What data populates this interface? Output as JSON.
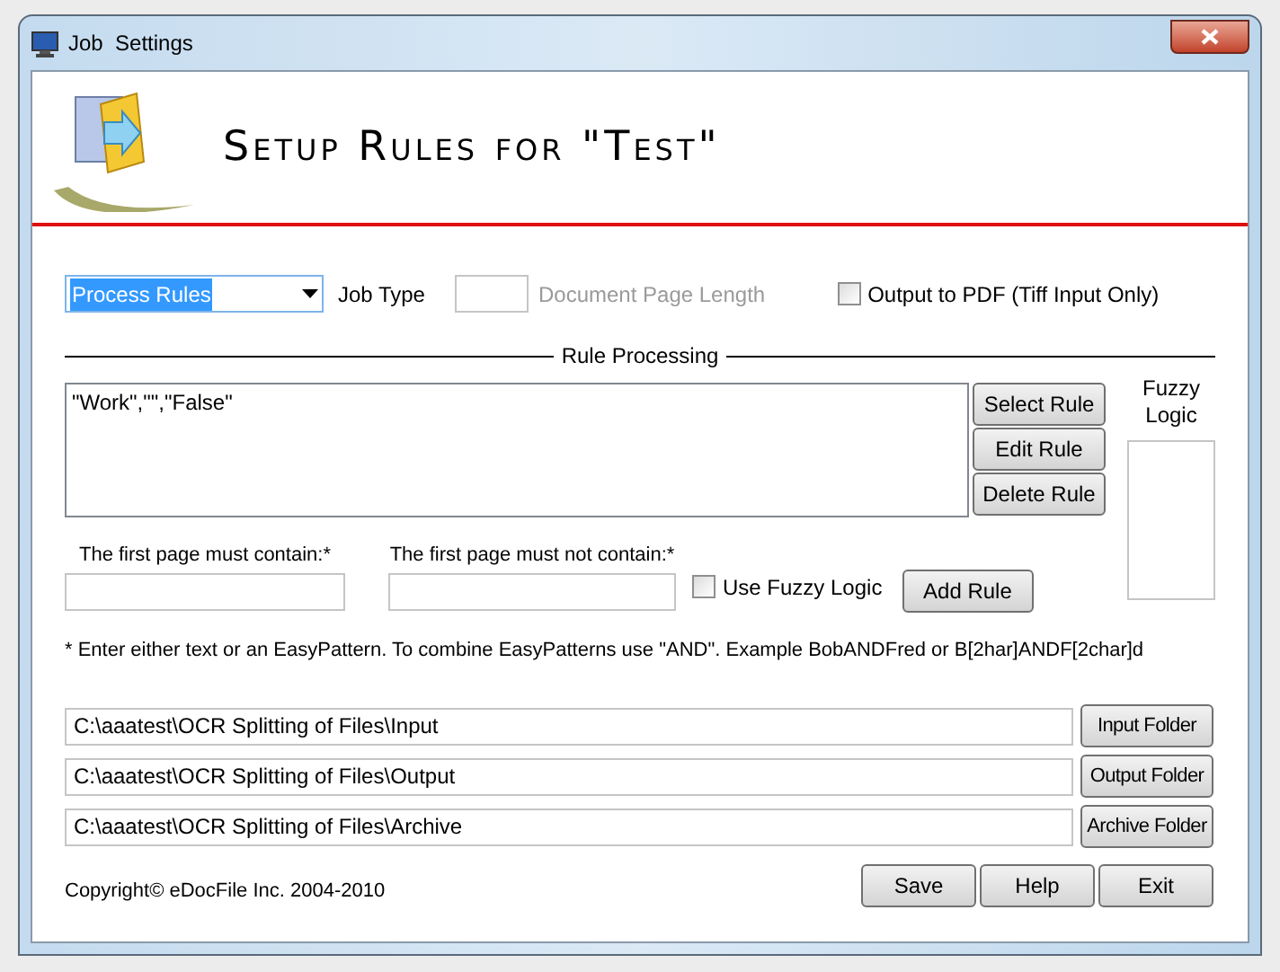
{
  "window": {
    "title": "Job  Settings"
  },
  "header": {
    "title": "Setup Rules for \"Test\""
  },
  "job_type_select": {
    "value": "Process Rules",
    "label": "Job Type"
  },
  "page_length": {
    "label": "Document Page Length",
    "disabled": true
  },
  "output_pdf": {
    "label": "Output to PDF (Tiff Input Only)",
    "checked": false
  },
  "rule_processing": {
    "title": "Rule Processing",
    "rules": [
      "\"Work\",\"\",\"False\""
    ]
  },
  "rule_buttons": [
    "Select Rule",
    "Edit Rule",
    "Delete Rule"
  ],
  "fuzzy_panel": {
    "title": "Fuzzy Logic"
  },
  "must_contain": {
    "label": "The first page must contain:*"
  },
  "must_not_contain": {
    "label": "The first page must not contain:*"
  },
  "use_fuzzy": {
    "label": "Use Fuzzy Logic",
    "checked": false
  },
  "add_rule": "Add Rule",
  "note": "* Enter either text or an EasyPattern. To combine EasyPatterns use \"AND\". Example BobANDFred or B[2har]ANDF[2char]d",
  "folders": [
    {
      "path": "C:\\aaatest\\OCR Splitting of Files\\Input",
      "button": "Input Folder"
    },
    {
      "path": "C:\\aaatest\\OCR Splitting of Files\\Output",
      "button": "Output Folder"
    },
    {
      "path": "C:\\aaatest\\OCR Splitting of Files\\Archive",
      "button": "Archive Folder"
    }
  ],
  "copyright": "Copyright© eDocFile Inc. 2004-2010",
  "footer_buttons": [
    "Save",
    "Help",
    "Exit"
  ]
}
